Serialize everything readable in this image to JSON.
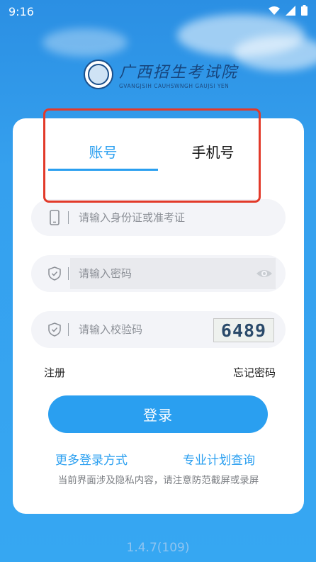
{
  "status_bar": {
    "time": "9:16",
    "icons": [
      "wifi-icon",
      "signal-icon",
      "battery-icon"
    ]
  },
  "logo": {
    "name_cn": "广西招生考试院",
    "name_en": "GVANGJSIH CAUHSWNGH GAUJSI YEN"
  },
  "tabs": [
    {
      "label": "账号",
      "active": true
    },
    {
      "label": "手机号",
      "active": false
    }
  ],
  "fields": {
    "id": {
      "placeholder": "请输入身份证或准考证",
      "icon": "phone-icon"
    },
    "password": {
      "placeholder": "请输入密码",
      "icon": "shield-icon",
      "toggle_icon": "eye-icon"
    },
    "captcha": {
      "placeholder": "请输入校验码",
      "icon": "shield-icon",
      "code": "6489"
    }
  },
  "links": {
    "register": "注册",
    "forgot": "忘记密码"
  },
  "login_button": "登录",
  "more": {
    "more_login": "更多登录方式",
    "plan_query": "专业计划查询"
  },
  "privacy_note": "当前界面涉及隐私内容，请注意防范截屏或录屏",
  "version": "1.4.7(109)",
  "colors": {
    "accent": "#2a9ff0",
    "background": "#36a7f2",
    "highlight": "#e23a2a"
  }
}
